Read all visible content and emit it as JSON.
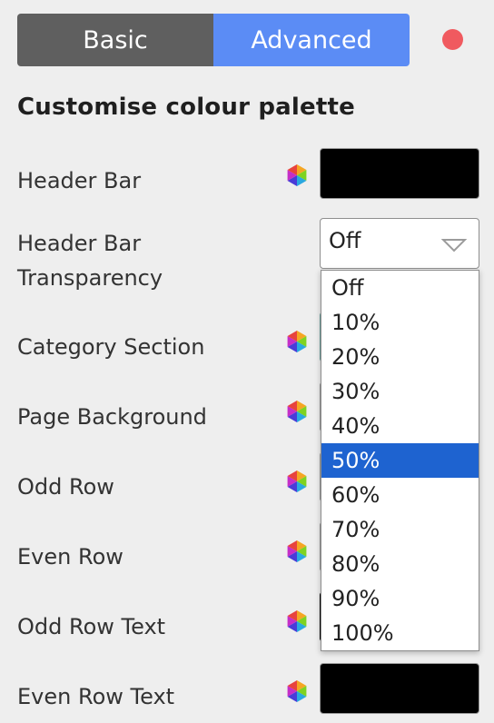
{
  "tabs": {
    "basic": "Basic",
    "advanced": "Advanced"
  },
  "heading": "Customise colour palette",
  "rows": [
    {
      "label": "Header Bar"
    },
    {
      "label_line1": "Header Bar",
      "label_line2": "Transparency"
    },
    {
      "label": "Category Section"
    },
    {
      "label": "Page Background"
    },
    {
      "label": "Odd Row"
    },
    {
      "label": "Even Row"
    },
    {
      "label": "Odd Row Text"
    },
    {
      "label": "Even Row Text"
    }
  ],
  "transparency": {
    "value": "Off",
    "options": [
      "Off",
      "10%",
      "20%",
      "30%",
      "40%",
      "50%",
      "60%",
      "70%",
      "80%",
      "90%",
      "100%"
    ],
    "highlighted": "50%"
  },
  "colors": {
    "header_bar": "#000000",
    "even_row_text": "#000000",
    "tab_basic_bg": "#5f5f5f",
    "tab_active_bg": "#5b8cf5",
    "status_dot": "#f05a5f",
    "highlight": "#1e63d0"
  },
  "icons": {
    "color_picker": "color-hexagon-icon",
    "dropdown_arrow": "triangle-down-icon",
    "status": "status-dot-icon"
  }
}
